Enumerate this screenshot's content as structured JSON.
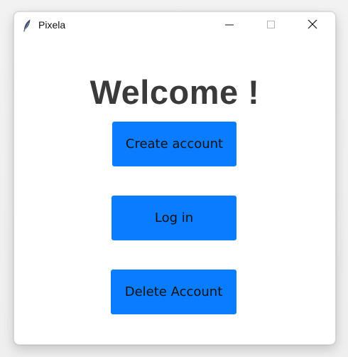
{
  "window": {
    "title": "Pixela",
    "app_icon": "feather-icon",
    "controls": {
      "minimize_icon": "minimize-icon",
      "maximize_icon": "maximize-icon",
      "close_icon": "close-icon"
    }
  },
  "main": {
    "heading": "Welcome !",
    "buttons": {
      "create": "Create account",
      "login": "Log in",
      "delete": "Delete Account"
    }
  },
  "colors": {
    "button_bg": "#0a7cff",
    "heading_text": "#3a3a3a"
  }
}
